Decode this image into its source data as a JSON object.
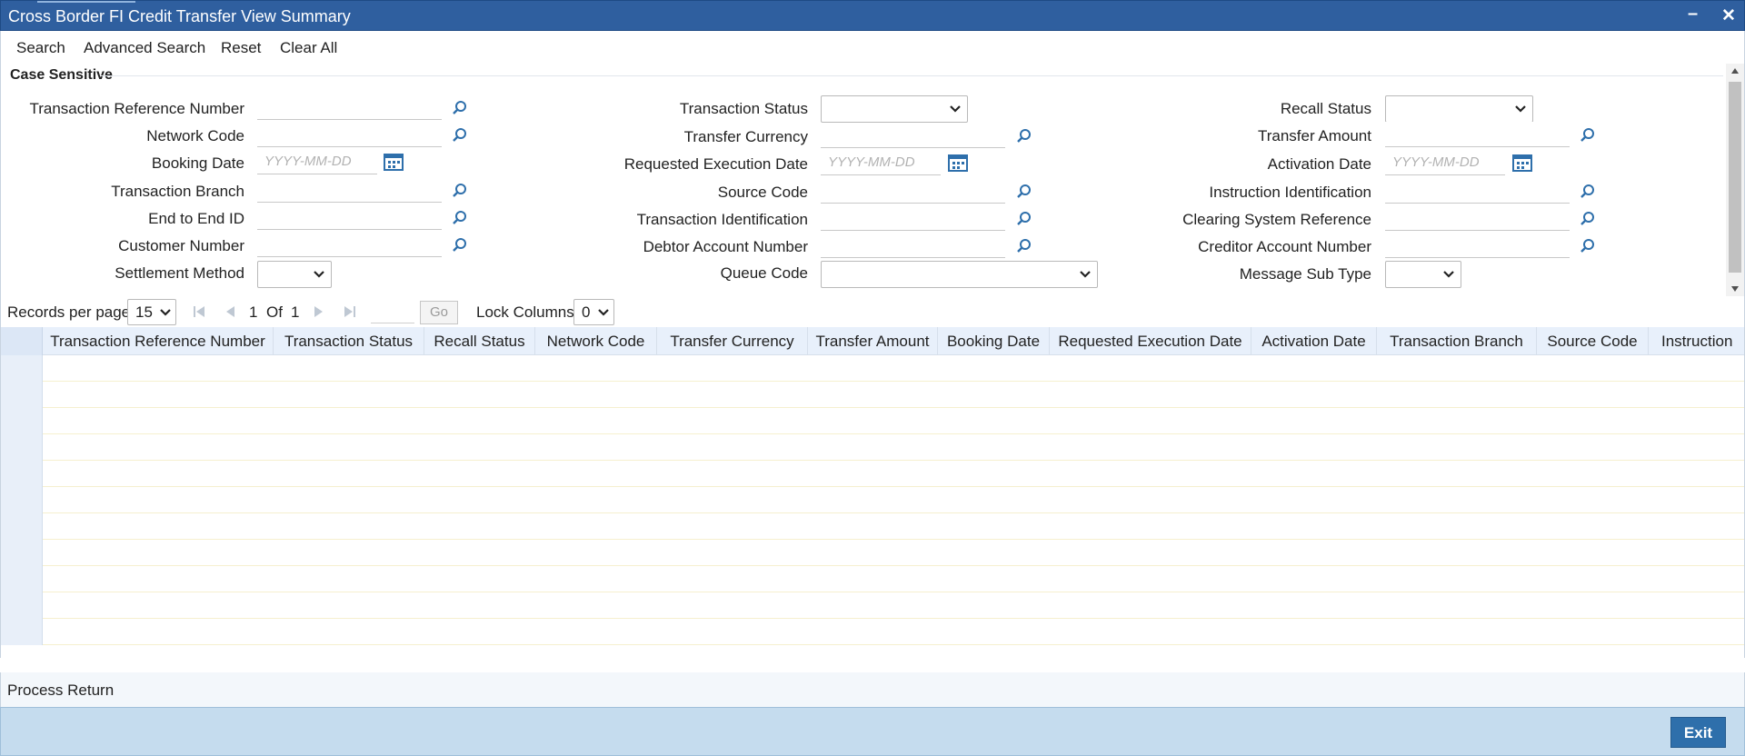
{
  "window": {
    "title": "Cross Border FI Credit Transfer View Summary",
    "minimize": "–",
    "close": "✕"
  },
  "menu": [
    "Search",
    "Advanced Search",
    "Reset",
    "Clear All"
  ],
  "form": {
    "section_title": "Case Sensitive",
    "date_placeholder": "YYYY-MM-DD",
    "col1": {
      "txn_ref": "Transaction Reference Number",
      "network_code": "Network Code",
      "booking_date": "Booking Date",
      "txn_branch": "Transaction Branch",
      "e2e_id": "End to End ID",
      "customer_number": "Customer Number",
      "settlement_method": "Settlement Method"
    },
    "col2": {
      "txn_status": "Transaction Status",
      "transfer_currency": "Transfer Currency",
      "req_exec_date": "Requested Execution Date",
      "source_code": "Source Code",
      "txn_identification": "Transaction Identification",
      "debtor_account": "Debtor Account Number",
      "queue_code": "Queue Code"
    },
    "col3": {
      "recall_status": "Recall Status",
      "transfer_amount": "Transfer Amount",
      "activation_date": "Activation Date",
      "instruction_id": "Instruction Identification",
      "clearing_ref": "Clearing System Reference",
      "creditor_account": "Creditor Account Number",
      "message_sub_type": "Message Sub Type"
    }
  },
  "pager": {
    "records_label": "Records per page",
    "records_value": "15",
    "page": "1",
    "of_label": "Of",
    "total_pages": "1",
    "go_label": "Go",
    "lock_label": "Lock Columns",
    "lock_value": "0"
  },
  "grid": {
    "columns": [
      "Transaction Reference Number",
      "Transaction Status",
      "Recall Status",
      "Network Code",
      "Transfer Currency",
      "Transfer Amount",
      "Booking Date",
      "Requested Execution Date",
      "Activation Date",
      "Transaction Branch",
      "Source Code",
      "Instruction"
    ]
  },
  "footer": {
    "process_return": "Process Return",
    "exit": "Exit"
  },
  "colors": {
    "titlebar": "#2f5f9f",
    "accent": "#2e6fab",
    "footer": "#c5dcee",
    "icon": "#2e6fab"
  }
}
